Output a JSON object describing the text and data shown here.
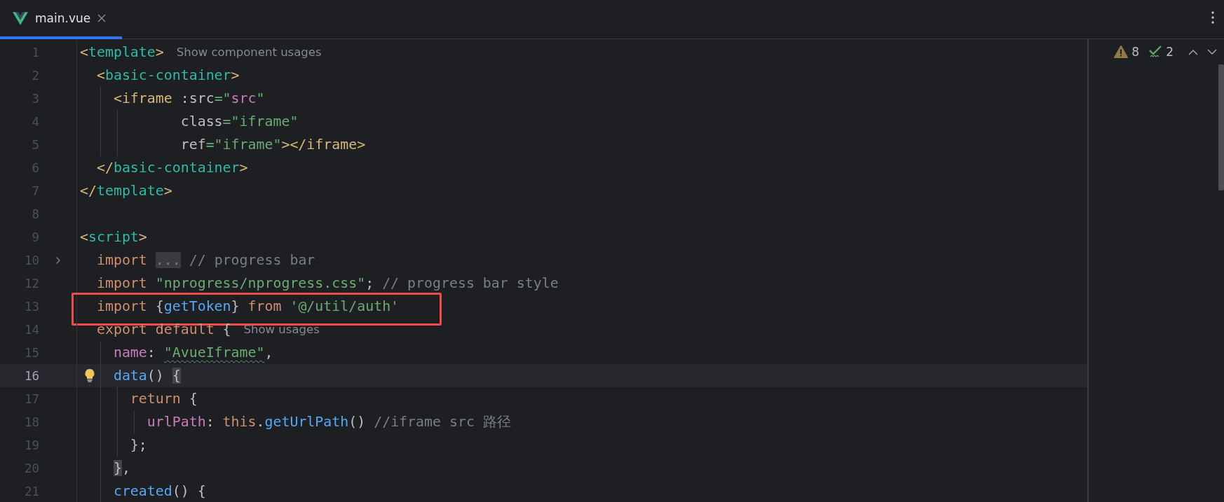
{
  "tabs": [
    {
      "label": "main.vue",
      "selected": true
    }
  ],
  "inspections": {
    "warnings": "8",
    "weak_warnings": "2"
  },
  "lines": [
    {
      "number": "1",
      "current": false,
      "folded": false,
      "highlighted": false,
      "bulb": false,
      "tokens": [
        {
          "kind": "bracket",
          "text": "<"
        },
        {
          "kind": "tag",
          "text": "template"
        },
        {
          "kind": "bracket",
          "text": ">"
        },
        {
          "kind": "hint",
          "text": "Show component usages"
        }
      ]
    },
    {
      "number": "2",
      "current": false,
      "folded": false,
      "highlighted": false,
      "bulb": false,
      "tokens": [
        {
          "kind": "bracket",
          "text": "  <"
        },
        {
          "kind": "tag",
          "text": "basic-container"
        },
        {
          "kind": "bracket",
          "text": ">"
        }
      ]
    },
    {
      "number": "3",
      "current": false,
      "folded": false,
      "highlighted": false,
      "bulb": false,
      "tokens": [
        {
          "kind": "bracket",
          "text": "    <"
        },
        {
          "kind": "tagname",
          "text": "iframe"
        },
        {
          "kind": "attr",
          "text": " :src"
        },
        {
          "kind": "punct",
          "text": "=\""
        },
        {
          "kind": "property",
          "text": "src"
        },
        {
          "kind": "punct",
          "text": "\""
        }
      ]
    },
    {
      "number": "4",
      "current": false,
      "folded": false,
      "highlighted": false,
      "bulb": false,
      "tokens": [
        {
          "kind": "attr",
          "text": "            class"
        },
        {
          "kind": "string",
          "text": "=\"iframe\""
        }
      ]
    },
    {
      "number": "5",
      "current": false,
      "folded": false,
      "highlighted": false,
      "bulb": false,
      "tokens": [
        {
          "kind": "attr",
          "text": "            ref"
        },
        {
          "kind": "string",
          "text": "=\"iframe\""
        },
        {
          "kind": "bracket",
          "text": "></"
        },
        {
          "kind": "tagname",
          "text": "iframe"
        },
        {
          "kind": "bracket",
          "text": ">"
        }
      ]
    },
    {
      "number": "6",
      "current": false,
      "folded": false,
      "highlighted": false,
      "bulb": false,
      "tokens": [
        {
          "kind": "bracket",
          "text": "  </"
        },
        {
          "kind": "tag",
          "text": "basic-container"
        },
        {
          "kind": "bracket",
          "text": ">"
        }
      ]
    },
    {
      "number": "7",
      "current": false,
      "folded": false,
      "highlighted": false,
      "bulb": false,
      "tokens": [
        {
          "kind": "bracket",
          "text": "</"
        },
        {
          "kind": "tag",
          "text": "template"
        },
        {
          "kind": "bracket",
          "text": ">"
        }
      ]
    },
    {
      "number": "8",
      "current": false,
      "folded": false,
      "highlighted": false,
      "bulb": false
    },
    {
      "number": "9",
      "current": false,
      "folded": false,
      "highlighted": false,
      "bulb": false,
      "tokens": [
        {
          "kind": "bracket",
          "text": "<"
        },
        {
          "kind": "tag",
          "text": "script"
        },
        {
          "kind": "bracket",
          "text": ">"
        }
      ]
    },
    {
      "number": "10",
      "current": false,
      "folded": true,
      "highlighted": false,
      "bulb": false,
      "tokens": [
        {
          "kind": "keyword",
          "text": "  import "
        },
        {
          "kind": "collapsed",
          "text": "..."
        },
        {
          "kind": "comment",
          "text": " // progress bar"
        }
      ]
    },
    {
      "number": "12",
      "current": false,
      "folded": false,
      "highlighted": false,
      "bulb": false,
      "tokens": [
        {
          "kind": "keyword",
          "text": "  import "
        },
        {
          "kind": "string",
          "text": "\"nprogress/nprogress.css\""
        },
        {
          "kind": "plain",
          "text": "; "
        },
        {
          "kind": "comment",
          "text": "// progress bar style"
        }
      ]
    },
    {
      "number": "13",
      "current": false,
      "folded": false,
      "highlighted": true,
      "bulb": false,
      "tokens": [
        {
          "kind": "keyword",
          "text": "  import "
        },
        {
          "kind": "plain",
          "text": "{"
        },
        {
          "kind": "function",
          "text": "getToken"
        },
        {
          "kind": "plain",
          "text": "} "
        },
        {
          "kind": "keyword",
          "text": "from "
        },
        {
          "kind": "string",
          "text": "'@/util/auth'"
        }
      ]
    },
    {
      "number": "14",
      "current": false,
      "folded": false,
      "highlighted": false,
      "bulb": false,
      "tokens": [
        {
          "kind": "keyword",
          "text": "  export default "
        },
        {
          "kind": "plain",
          "text": "{"
        },
        {
          "kind": "hint",
          "text": "Show usages"
        }
      ]
    },
    {
      "number": "15",
      "current": false,
      "folded": false,
      "highlighted": false,
      "bulb": false,
      "tokens": [
        {
          "kind": "property",
          "text": "    name"
        },
        {
          "kind": "plain",
          "text": ": "
        },
        {
          "kind": "typo",
          "text": "\"AvueIframe\""
        },
        {
          "kind": "plain",
          "text": ","
        }
      ]
    },
    {
      "number": "16",
      "current": true,
      "folded": false,
      "highlighted": false,
      "bulb": true,
      "tokens": [
        {
          "kind": "function",
          "text": "    data"
        },
        {
          "kind": "plain",
          "text": "() "
        },
        {
          "kind": "matched",
          "text": "{"
        }
      ]
    },
    {
      "number": "17",
      "current": false,
      "folded": false,
      "highlighted": false,
      "bulb": false,
      "tokens": [
        {
          "kind": "keyword",
          "text": "      return "
        },
        {
          "kind": "plain",
          "text": "{"
        }
      ]
    },
    {
      "number": "18",
      "current": false,
      "folded": false,
      "highlighted": false,
      "bulb": false,
      "tokens": [
        {
          "kind": "property",
          "text": "        urlPath"
        },
        {
          "kind": "plain",
          "text": ": "
        },
        {
          "kind": "keyword",
          "text": "this"
        },
        {
          "kind": "plain",
          "text": "."
        },
        {
          "kind": "function",
          "text": "getUrlPath"
        },
        {
          "kind": "plain",
          "text": "() "
        },
        {
          "kind": "comment",
          "text": "//iframe src 路径"
        }
      ]
    },
    {
      "number": "19",
      "current": false,
      "folded": false,
      "highlighted": false,
      "bulb": false,
      "tokens": [
        {
          "kind": "plain",
          "text": "      };"
        }
      ]
    },
    {
      "number": "20",
      "current": false,
      "folded": false,
      "highlighted": false,
      "bulb": false,
      "tokens": [
        {
          "kind": "matched",
          "text": "    }"
        },
        {
          "kind": "plain",
          "text": ","
        }
      ]
    },
    {
      "number": "21",
      "current": false,
      "folded": false,
      "highlighted": false,
      "bulb": false,
      "tokens": [
        {
          "kind": "function",
          "text": "    created"
        },
        {
          "kind": "plain",
          "text": "() {"
        }
      ]
    }
  ]
}
